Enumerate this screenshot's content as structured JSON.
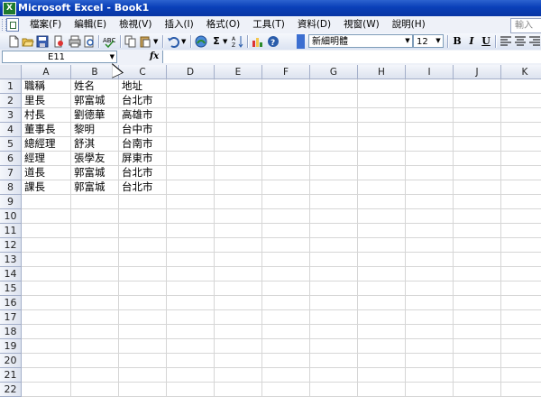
{
  "window": {
    "title": "Microsoft Excel - Book1"
  },
  "menu": {
    "items": [
      "檔案(F)",
      "編輯(E)",
      "檢視(V)",
      "插入(I)",
      "格式(O)",
      "工具(T)",
      "資料(D)",
      "視窗(W)",
      "說明(H)"
    ],
    "question_box": "輸入"
  },
  "toolbar": {
    "font_name": "新細明體",
    "font_size": "12",
    "bold_label": "B",
    "italic_label": "I",
    "underline_label": "U",
    "sum_label": "Σ",
    "icons": [
      "new-icon",
      "open-icon",
      "save-icon",
      "permission-icon",
      "print-icon",
      "print-preview-icon",
      "spelling-icon",
      "copy-icon",
      "paste-icon",
      "undo-icon",
      "hyperlink-icon",
      "autosum-icon",
      "sort-icon",
      "chart-icon",
      "help-icon"
    ]
  },
  "formula_bar": {
    "name_box": "E11",
    "fx_label": "fx",
    "formula": ""
  },
  "sheet": {
    "columns": [
      "A",
      "B",
      "C",
      "D",
      "E",
      "F",
      "G",
      "H",
      "I",
      "J",
      "K"
    ],
    "rows": [
      "1",
      "2",
      "3",
      "4",
      "5",
      "6",
      "7",
      "8",
      "9",
      "10",
      "11",
      "12",
      "13",
      "14",
      "15",
      "16",
      "17",
      "18",
      "19",
      "20",
      "21",
      "22"
    ],
    "cells": [
      [
        "職稱",
        "姓名",
        "地址"
      ],
      [
        "里長",
        "郭富城",
        "台北市"
      ],
      [
        "村長",
        "劉德華",
        "高雄市"
      ],
      [
        "董事長",
        "黎明",
        "台中市"
      ],
      [
        "總經理",
        "舒淇",
        "台南市"
      ],
      [
        "經理",
        "張學友",
        "屏東市"
      ],
      [
        "道長",
        "郭富城",
        "台北市"
      ],
      [
        "課長",
        "郭富城",
        "台北市"
      ]
    ]
  },
  "colors": {
    "titlebar": "#0a3fb8",
    "menubar": "#eef1f8",
    "header_bg": "#dde3ef",
    "gridline": "#d6d6d6"
  }
}
